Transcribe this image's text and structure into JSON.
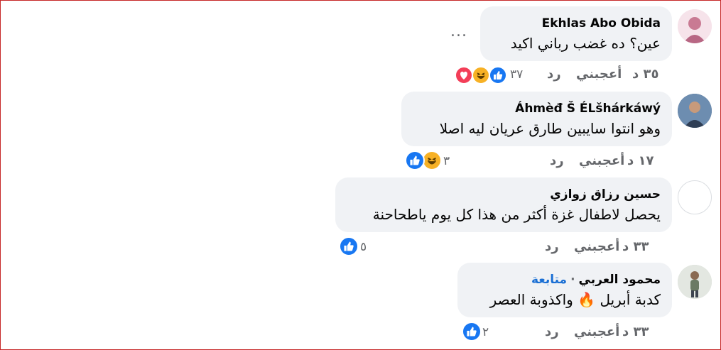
{
  "comments": [
    {
      "author": "Ekhlas Abo Obida",
      "text": "عين؟ ده غضب رباني اكيد",
      "time": "٣٥ د",
      "like_label": "أعجبني",
      "reply_label": "رد",
      "reaction_count": "٣٧",
      "reactions": [
        "like",
        "haha",
        "love"
      ],
      "more_label": "..."
    },
    {
      "author": "Áhmèđ Š ÉLšhárkáwý",
      "text": "وهو انتوا سايبين طارق عريان ليه اصلا",
      "time": "١٧ د",
      "like_label": "أعجبني",
      "reply_label": "رد",
      "reaction_count": "٣",
      "reactions": [
        "like",
        "haha"
      ]
    },
    {
      "author": "حسين رزاق زوازي",
      "text": "يحصل لاطفال غزة أكثر من هذا كل يوم ياطحاحنة",
      "time": "٣٣ د",
      "like_label": "أعجبني",
      "reply_label": "رد",
      "reaction_count": "٥",
      "reactions": [
        "like"
      ]
    },
    {
      "author": "محمود العربي",
      "follow_label": "متابعة",
      "text": "كدبة أبريل 🔥 واكذوبة العصر",
      "time": "٣٣ د",
      "like_label": "أعجبني",
      "reply_label": "رد",
      "reaction_count": "٢",
      "reactions": [
        "like"
      ]
    }
  ],
  "colors": {
    "like": "#1877f2",
    "haha": "#f7b125",
    "love": "#f33e58",
    "link": "#1a6fd4",
    "bubble": "#f0f2f5"
  }
}
